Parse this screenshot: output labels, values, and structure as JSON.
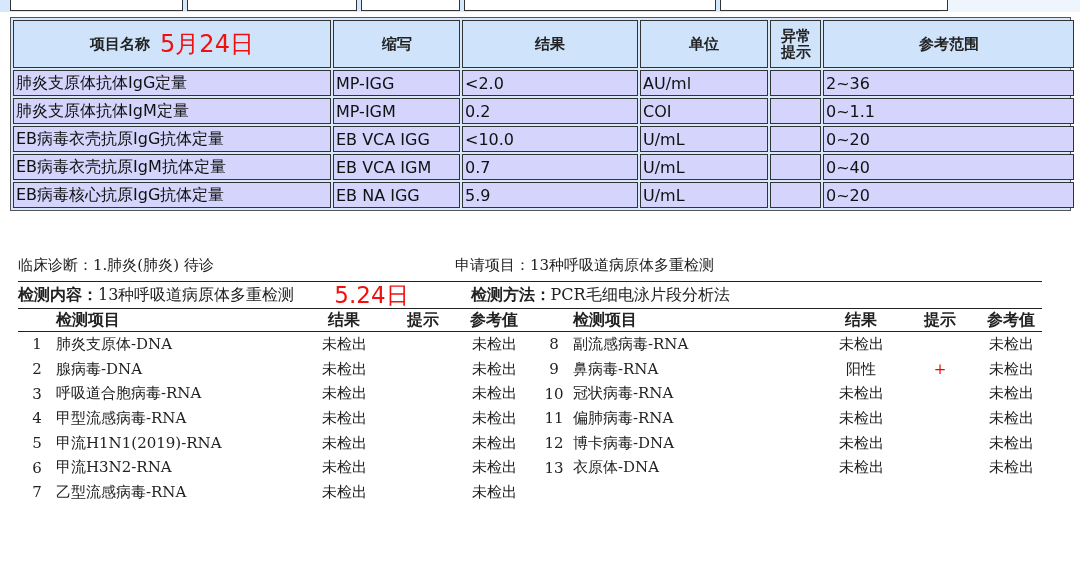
{
  "lab_table": {
    "columns": [
      {
        "label": "项目名称",
        "note": "5月24日"
      },
      {
        "label": "缩写"
      },
      {
        "label": "结果"
      },
      {
        "label": "单位"
      },
      {
        "label": "异常提示"
      },
      {
        "label": "参考范围"
      }
    ],
    "rows": [
      {
        "name": "肺炎支原体抗体IgG定量",
        "abbr": "MP-IGG",
        "result": "<2.0",
        "unit": "AU/ml",
        "ref": "2~36"
      },
      {
        "name": "肺炎支原体抗体IgM定量",
        "abbr": "MP-IGM",
        "result": "0.2",
        "unit": "COI",
        "ref": "0~1.1"
      },
      {
        "name": "EB病毒衣壳抗原IgG抗体定量",
        "abbr": "EB VCA IGG",
        "result": "<10.0",
        "unit": "U/mL",
        "ref": "0~20"
      },
      {
        "name": "EB病毒衣壳抗原IgM抗体定量",
        "abbr": "EB VCA IGM",
        "result": "0.7",
        "unit": "U/mL",
        "ref": "0~40"
      },
      {
        "name": "EB病毒核心抗原IgG抗体定量",
        "abbr": "EB NA IGG",
        "result": "5.9",
        "unit": "U/mL",
        "ref": "0~20"
      }
    ]
  },
  "pcr_report": {
    "diagnosis": "临床诊断：1.肺炎(肺炎) 待诊",
    "request": "申请项目：13种呼吸道病原体多重检测",
    "content_label": "检测内容：",
    "content": "13种呼吸道病原体多重检测",
    "date_note": "5.24日",
    "method_label": "检测方法：",
    "method": "PCR毛细电泳片段分析法",
    "left_columns": [
      "检测项目",
      "结果",
      "提示",
      "参考值"
    ],
    "right_columns": [
      "检测项目",
      "结果",
      "提示",
      "参考值"
    ],
    "left_rows": [
      {
        "no": "1",
        "item": "肺炎支原体-DNA",
        "result": "未检出",
        "ref": "未检出"
      },
      {
        "no": "2",
        "item": "腺病毒-DNA",
        "result": "未检出",
        "ref": "未检出"
      },
      {
        "no": "3",
        "item": "呼吸道合胞病毒-RNA",
        "result": "未检出",
        "ref": "未检出"
      },
      {
        "no": "4",
        "item": "甲型流感病毒-RNA",
        "result": "未检出",
        "ref": "未检出"
      },
      {
        "no": "5",
        "item": "甲流H1N1(2019)-RNA",
        "result": "未检出",
        "ref": "未检出"
      },
      {
        "no": "6",
        "item": "甲流H3N2-RNA",
        "result": "未检出",
        "ref": "未检出"
      },
      {
        "no": "7",
        "item": "乙型流感病毒-RNA",
        "result": "未检出",
        "ref": "未检出"
      }
    ],
    "right_rows": [
      {
        "no": "8",
        "item": "副流感病毒-RNA",
        "result": "未检出",
        "ref": "未检出"
      },
      {
        "no": "9",
        "item": "鼻病毒-RNA",
        "result": "阳性",
        "hint": "+",
        "ref": "未检出"
      },
      {
        "no": "10",
        "item": "冠状病毒-RNA",
        "result": "未检出",
        "ref": "未检出"
      },
      {
        "no": "11",
        "item": "偏肺病毒-RNA",
        "result": "未检出",
        "ref": "未检出"
      },
      {
        "no": "12",
        "item": "博卡病毒-DNA",
        "result": "未检出",
        "ref": "未检出"
      },
      {
        "no": "13",
        "item": "衣原体-DNA",
        "result": "未检出",
        "ref": "未检出"
      }
    ]
  }
}
